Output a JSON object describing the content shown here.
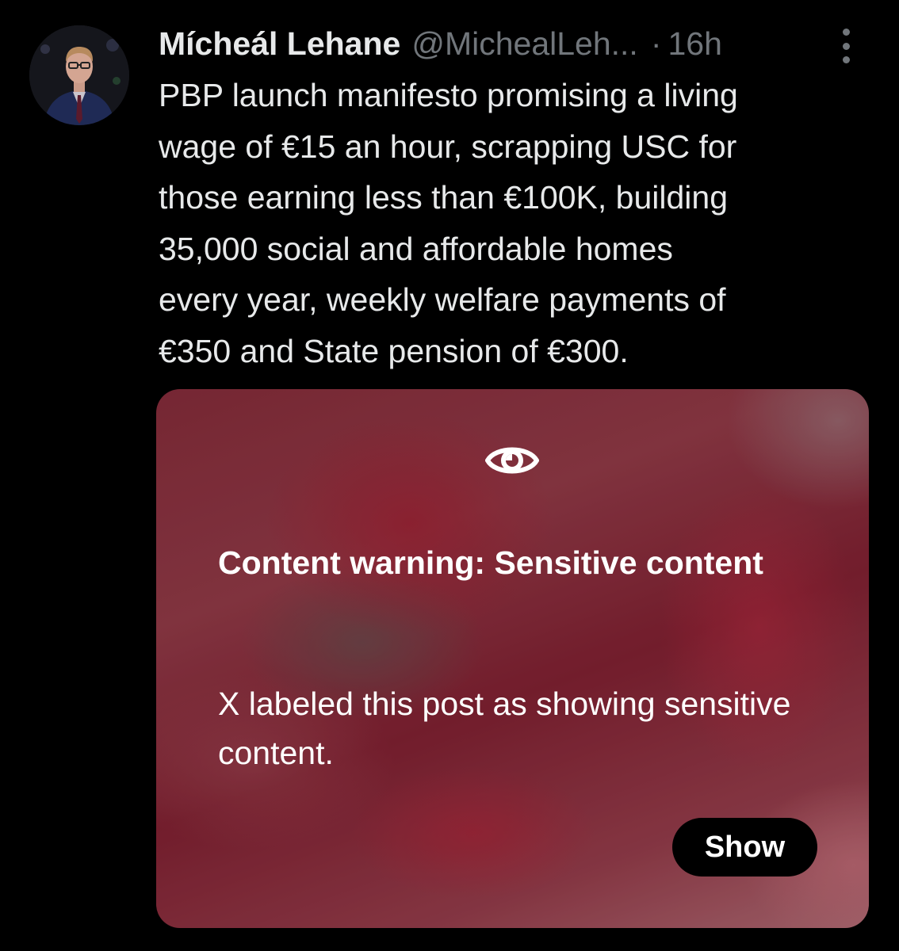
{
  "post": {
    "author": {
      "display_name": "Mícheál Lehane",
      "handle": "@MichealLeh...",
      "avatar_icon": "profile-photo"
    },
    "separator": "·",
    "timestamp": "16h",
    "more_icon": "more-vertical-icon",
    "text": "PBP launch manifesto promising a living\nwage of €15 an hour, scrapping USC for\nthose earning less than €100K, building\n35,000 social and affordable homes\nevery year, weekly welfare payments of\n€350 and State pension  of €300."
  },
  "media": {
    "eye_icon": "eye-icon",
    "warning_title": "Content warning: Sensitive content",
    "warning_body": "X labeled this post as showing sensitive content.",
    "show_label": "Show"
  },
  "colors": {
    "background": "#000000",
    "primary_text": "#e7e9ea",
    "secondary_text": "#71767b",
    "button_bg": "#000000",
    "button_text": "#ffffff",
    "media_tint": "#8a3945"
  }
}
